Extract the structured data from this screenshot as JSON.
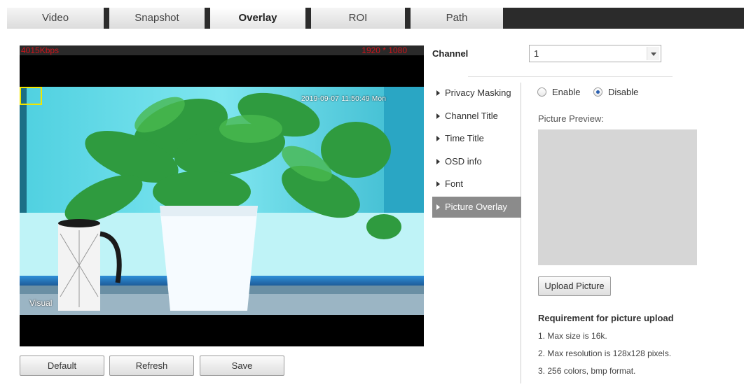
{
  "tabs": [
    {
      "label": "Video",
      "active": false
    },
    {
      "label": "Snapshot",
      "active": false
    },
    {
      "label": "Overlay",
      "active": true
    },
    {
      "label": "ROI",
      "active": false
    },
    {
      "label": "Path",
      "active": false
    }
  ],
  "video": {
    "bitrate": "4015Kbps",
    "resolution": "1920 * 1080",
    "timestamp": "2019-09-07 11:50:49 Mon",
    "channel_name": "Visual"
  },
  "buttons": {
    "default": "Default",
    "refresh": "Refresh",
    "save": "Save"
  },
  "channel": {
    "label": "Channel",
    "value": "1"
  },
  "menu": [
    {
      "label": "Privacy Masking",
      "active": false
    },
    {
      "label": "Channel Title",
      "active": false
    },
    {
      "label": "Time Title",
      "active": false
    },
    {
      "label": "OSD info",
      "active": false
    },
    {
      "label": "Font",
      "active": false
    },
    {
      "label": "Picture Overlay",
      "active": true
    }
  ],
  "picture_overlay": {
    "enable_label": "Enable",
    "disable_label": "Disable",
    "selected": "Disable",
    "preview_label": "Picture Preview:",
    "upload_label": "Upload Picture",
    "requirement_title": "Requirement for picture upload",
    "requirements": [
      "1. Max size is 16k.",
      "2. Max resolution is 128x128 pixels.",
      "3. 256 colors, bmp format."
    ]
  },
  "colors": {
    "tab_bar": "#2b2b2b",
    "osd_text": "#d0141b",
    "privacy_mask_box": "#f2e600",
    "active_menu": "#8b8b8b",
    "preview_box": "#d6d6d6"
  }
}
